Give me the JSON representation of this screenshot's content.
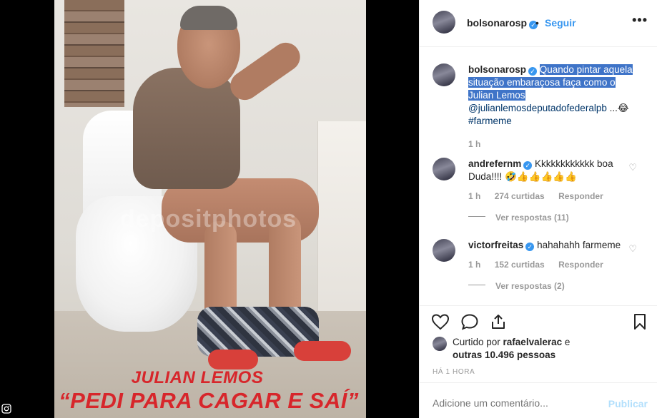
{
  "image": {
    "watermark": "depositphotos",
    "caption_line1": "JULIAN LEMOS",
    "caption_line2": "“PEDI PARA CAGAR E SAÍ”"
  },
  "header": {
    "username": "bolsonarosp",
    "separator": "•",
    "follow_label": "Seguir",
    "more_icon": "more-horizontal-icon"
  },
  "caption": {
    "username": "bolsonarosp",
    "text_highlighted": "Quando pintar aquela situação embaraçosa faça como o Julian Lemos",
    "mention": "@julianlemosdeputadofederalpb",
    "suffix": " ...😂",
    "hashtag": "#farmeme",
    "time": "1 h"
  },
  "comments": [
    {
      "username": "andrefernm",
      "text": "Kkkkkkkkkkkk boa Duda!!!! 🤣👍👍👍👍👍",
      "time": "1 h",
      "likes": "274 curtidas",
      "reply_label": "Responder",
      "view_replies": "Ver respostas (11)"
    },
    {
      "username": "victorfreitas",
      "text": "hahahahh farmeme",
      "time": "1 h",
      "likes": "152 curtidas",
      "reply_label": "Responder",
      "view_replies": "Ver respostas (2)"
    }
  ],
  "liked_by": {
    "prefix": "Curtido por ",
    "user": "rafaelvalerac",
    "middle": " e",
    "others": "outras 10.496 pessoas"
  },
  "post_time": "HÁ 1 HORA",
  "add_comment": {
    "placeholder": "Adicione um comentário...",
    "publish_label": "Publicar"
  },
  "colors": {
    "accent": "#3897f0",
    "highlight": "#3f74c8",
    "caption_red": "#d7262b"
  }
}
